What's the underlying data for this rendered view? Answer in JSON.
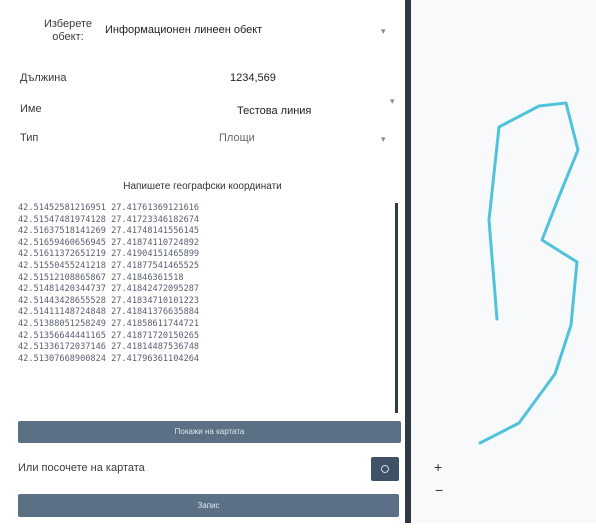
{
  "form": {
    "object_label_line1": "Изберете",
    "object_label_line2": "обект:",
    "object_value": "Информационен линеен обект",
    "length_label": "Дължина",
    "length_value": "1234,569",
    "name_label": "Име",
    "name_value": "Тестова линия",
    "type_label": "Тип",
    "type_value": "Площи",
    "coords_title": "Напишете географски координати",
    "coords": [
      "42.51452581216951  27.41761369121616",
      "42.51547481974128  27.41723346182674",
      "42.51637518141269  27.41748141556145",
      "42.51659460656945  27.41874110724892",
      "42.51611372651219  27.41904151465899",
      "42.51550455241218  27.41877541465525",
      "42.51512108865867  27.41846361518  ",
      "42.51481420344737  27.41842472095287",
      "42.51443428655528  27.41834710101223",
      "42.51411148724848  27.41841376635884",
      "42.51388051258249  27.41858611744721",
      "42.51356644441165  27.41871720150265",
      "42.51336172037146  27.41814487536748",
      "42.51307668900824  27.41796361104264"
    ],
    "show_on_map_label": "Покажи на картата",
    "or_point_label": "Или посочете на картата",
    "save_label": "Запис"
  },
  "map": {
    "line_color": "#4fc3d9",
    "zoom_in": "+",
    "zoom_out": "−"
  }
}
